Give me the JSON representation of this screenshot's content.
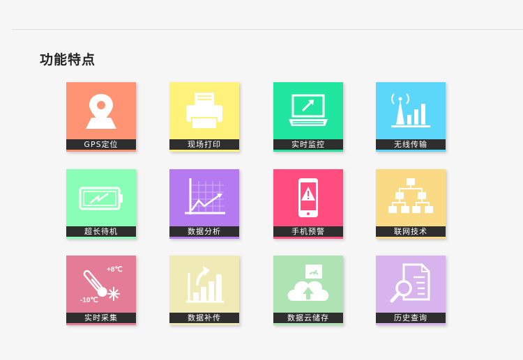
{
  "section": {
    "title": "功能特点"
  },
  "features": [
    {
      "label": "GPS定位",
      "icon": "map-pin-icon",
      "color": "#ff9475"
    },
    {
      "label": "现场打印",
      "icon": "printer-icon",
      "color": "#fff27a"
    },
    {
      "label": "实时监控",
      "icon": "laptop-icon",
      "color": "#20e6a0"
    },
    {
      "label": "无线传输",
      "icon": "signal-tower-icon",
      "color": "#5cd7fa"
    },
    {
      "label": "超长待机",
      "icon": "battery-icon",
      "color": "#88ffb4"
    },
    {
      "label": "数据分析",
      "icon": "line-chart-icon",
      "color": "#b57aef"
    },
    {
      "label": "手机预警",
      "icon": "phone-alert-icon",
      "color": "#ff4d80"
    },
    {
      "label": "联网技术",
      "icon": "network-tree-icon",
      "color": "#fbda85"
    },
    {
      "label": "实时采集",
      "icon": "thermometer-icon",
      "color": "#e47c95",
      "temp_high": "+8℃",
      "temp_low": "-10℃"
    },
    {
      "label": "数据补传",
      "icon": "bar-upload-icon",
      "color": "#f0ebb6"
    },
    {
      "label": "数据云储存",
      "icon": "cloud-upload-icon",
      "color": "#aee4b4"
    },
    {
      "label": "历史查询",
      "icon": "document-search-icon",
      "color": "#d7b4ee"
    }
  ]
}
